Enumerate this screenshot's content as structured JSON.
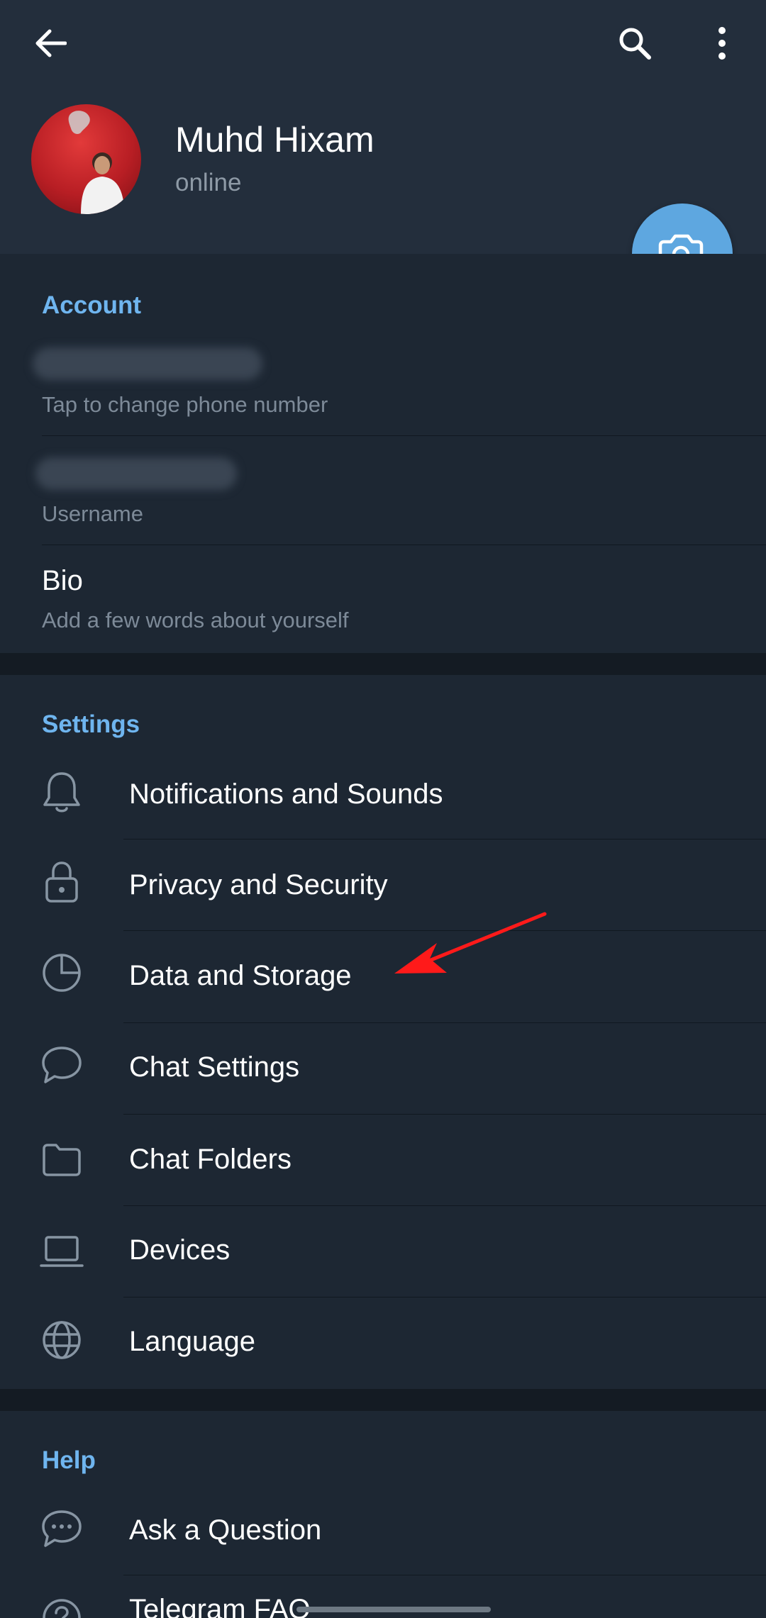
{
  "profile": {
    "name": "Muhd Hixam",
    "status": "online"
  },
  "account": {
    "title": "Account",
    "phone_hint": "Tap to change phone number",
    "username_hint": "Username",
    "bio_label": "Bio",
    "bio_hint": "Add a few words about yourself"
  },
  "settings": {
    "title": "Settings",
    "items": [
      {
        "label": "Notifications and Sounds",
        "icon": "bell-icon"
      },
      {
        "label": "Privacy and Security",
        "icon": "lock-icon"
      },
      {
        "label": "Data and Storage",
        "icon": "pie-chart-icon"
      },
      {
        "label": "Chat Settings",
        "icon": "chat-bubble-icon"
      },
      {
        "label": "Chat Folders",
        "icon": "folder-icon"
      },
      {
        "label": "Devices",
        "icon": "laptop-icon"
      },
      {
        "label": "Language",
        "icon": "globe-icon"
      }
    ]
  },
  "help": {
    "title": "Help",
    "items": [
      {
        "label": "Ask a Question",
        "icon": "chat-dots-icon"
      },
      {
        "label": "Telegram FAQ",
        "icon": "question-icon"
      }
    ]
  },
  "colors": {
    "accent": "#6fb5ef",
    "fab": "#5ea7e0",
    "background": "#1d2733",
    "header": "#232e3c",
    "annotation_arrow": "#ff1a1a"
  }
}
